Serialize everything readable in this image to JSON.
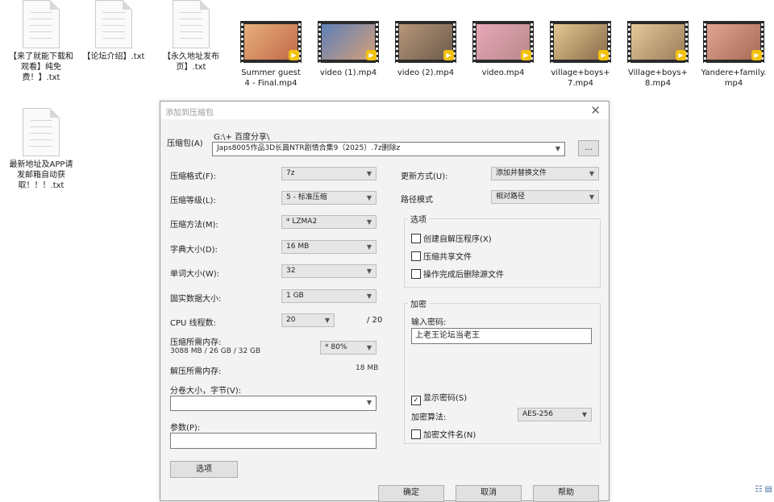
{
  "desktop": {
    "text_files": [
      {
        "name": "【来了就能下载和观看】纯免费！】.txt"
      },
      {
        "name": "【论坛介绍】.txt"
      },
      {
        "name": "【永久地址发布页】.txt"
      },
      {
        "name": "最新地址及APP请发邮箱自动获取！！！.txt"
      }
    ],
    "videos": [
      {
        "name": "Summer guest 4 - Final.mp4",
        "badge": "Player",
        "colors": [
          "#e7b07a",
          "#c2684a"
        ]
      },
      {
        "name": "video (1).mp4",
        "badge": "Player",
        "colors": [
          "#5e7fb8",
          "#d3a07a"
        ]
      },
      {
        "name": "video (2).mp4",
        "badge": "Player",
        "colors": [
          "#b9977a",
          "#6b5a4a"
        ]
      },
      {
        "name": "video.mp4",
        "badge": "Player",
        "colors": [
          "#e7a7b8",
          "#b98a8a"
        ]
      },
      {
        "name": "village+boys+7.mp4",
        "badge": "Player",
        "colors": [
          "#e4c890",
          "#8a6a4a"
        ]
      },
      {
        "name": "Village+boys+8.mp4",
        "badge": "Player",
        "colors": [
          "#e6c99a",
          "#9a7c5a"
        ]
      },
      {
        "name": "Yandere+family.mp4",
        "badge": "Player",
        "colors": [
          "#e2a590",
          "#a56a55"
        ]
      }
    ]
  },
  "dialog": {
    "title": "添加到压缩包",
    "archive_label": "压缩包(A)",
    "archive_dir": "G:\\+ 百度分享\\",
    "archive_file": "Japs8005作品3D长篇NTR剧情合集9（2025）.7z删除z",
    "browse_label": "...",
    "left": {
      "format_label": "压缩格式(F):",
      "format_value": "7z",
      "level_label": "压缩等级(L):",
      "level_value": "5 - 标准压缩",
      "method_label": "压缩方法(M):",
      "method_value": "* LZMA2",
      "dict_label": "字典大小(D):",
      "dict_value": "16 MB",
      "word_label": "单词大小(W):",
      "word_value": "32",
      "solid_label": "固实数据大小:",
      "solid_value": "1 GB",
      "cpu_label": "CPU 线程数:",
      "cpu_value": "20",
      "cpu_max": "/ 20",
      "mem_label": "压缩所需内存:",
      "mem_value": "3088 MB / 26 GB / 32 GB",
      "mem_pct": "* 80%",
      "decomp_label": "解压所需内存:",
      "decomp_value": "18 MB",
      "split_label": "分卷大小，字节(V):",
      "split_value": "",
      "params_label": "参数(P):",
      "params_value": "",
      "options_button": "选项"
    },
    "right": {
      "update_label": "更新方式(U):",
      "update_value": "添加并替换文件",
      "path_label": "路径模式",
      "path_value": "相对路径",
      "options_group": "选项",
      "opt_sfx": "创建自解压程序(X)",
      "opt_shared": "压缩共享文件",
      "opt_delete": "操作完成后删除源文件",
      "encrypt_group": "加密",
      "password_label": "输入密码:",
      "password_value": "上老王论坛当老王",
      "show_password": "显示密码(S)",
      "method_label": "加密算法:",
      "method_value": "AES-256",
      "encrypt_names": "加密文件名(N)"
    },
    "buttons": {
      "ok": "确定",
      "cancel": "取消",
      "help": "帮助"
    }
  }
}
